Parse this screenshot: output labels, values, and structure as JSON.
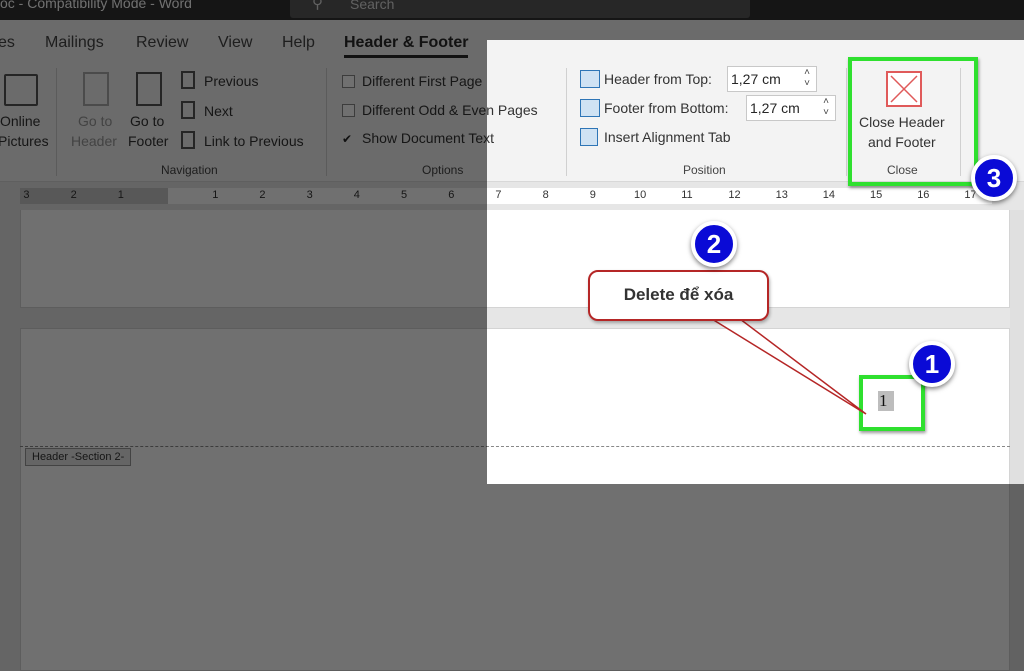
{
  "titlebar": {
    "title": "oc  -  Compatibility Mode  -  Word",
    "search_placeholder": "Search"
  },
  "tabs": [
    {
      "label": "es"
    },
    {
      "label": "Mailings"
    },
    {
      "label": "Review"
    },
    {
      "label": "View"
    },
    {
      "label": "Help"
    },
    {
      "label": "Header & Footer",
      "active": true
    }
  ],
  "ribbon": {
    "insert": {
      "online_pictures_1": "Online",
      "online_pictures_2": "Pictures"
    },
    "navigation": {
      "go_to_header_1": "Go to",
      "go_to_header_2": "Header",
      "go_to_footer_1": "Go to",
      "go_to_footer_2": "Footer",
      "previous": "Previous",
      "next": "Next",
      "link_to_previous": "Link to Previous",
      "group": "Navigation"
    },
    "options": {
      "different_first_page": "Different First Page",
      "different_odd_even": "Different Odd & Even Pages",
      "show_document_text": "Show Document Text",
      "show_document_text_checked": true,
      "group": "Options"
    },
    "position": {
      "header_from_top_label": "Header from Top:",
      "header_from_top_value": "1,27 cm",
      "footer_from_bottom_label": "Footer from Bottom:",
      "footer_from_bottom_value": "1,27 cm",
      "insert_alignment_tab": "Insert Alignment Tab",
      "group": "Position"
    },
    "close": {
      "label_1": "Close Header",
      "label_2": "and Footer",
      "group": "Close",
      "icon": "close-x-icon",
      "icon_color": "#e05a5a"
    }
  },
  "ruler": {
    "left_numbers": [
      "3",
      "2",
      "1"
    ],
    "numbers": [
      "1",
      "2",
      "3",
      "4",
      "5",
      "6",
      "7",
      "8",
      "9",
      "10",
      "11",
      "12",
      "13",
      "14",
      "15",
      "16",
      "17"
    ]
  },
  "document": {
    "header_label": "Header -Section 2-",
    "page_number": "1"
  },
  "annotations": {
    "badge1": "1",
    "badge2": "2",
    "badge3": "3",
    "callout": "Delete để xóa",
    "highlight_color": "#2fe02f",
    "badge_color": "#0a0ad6"
  }
}
